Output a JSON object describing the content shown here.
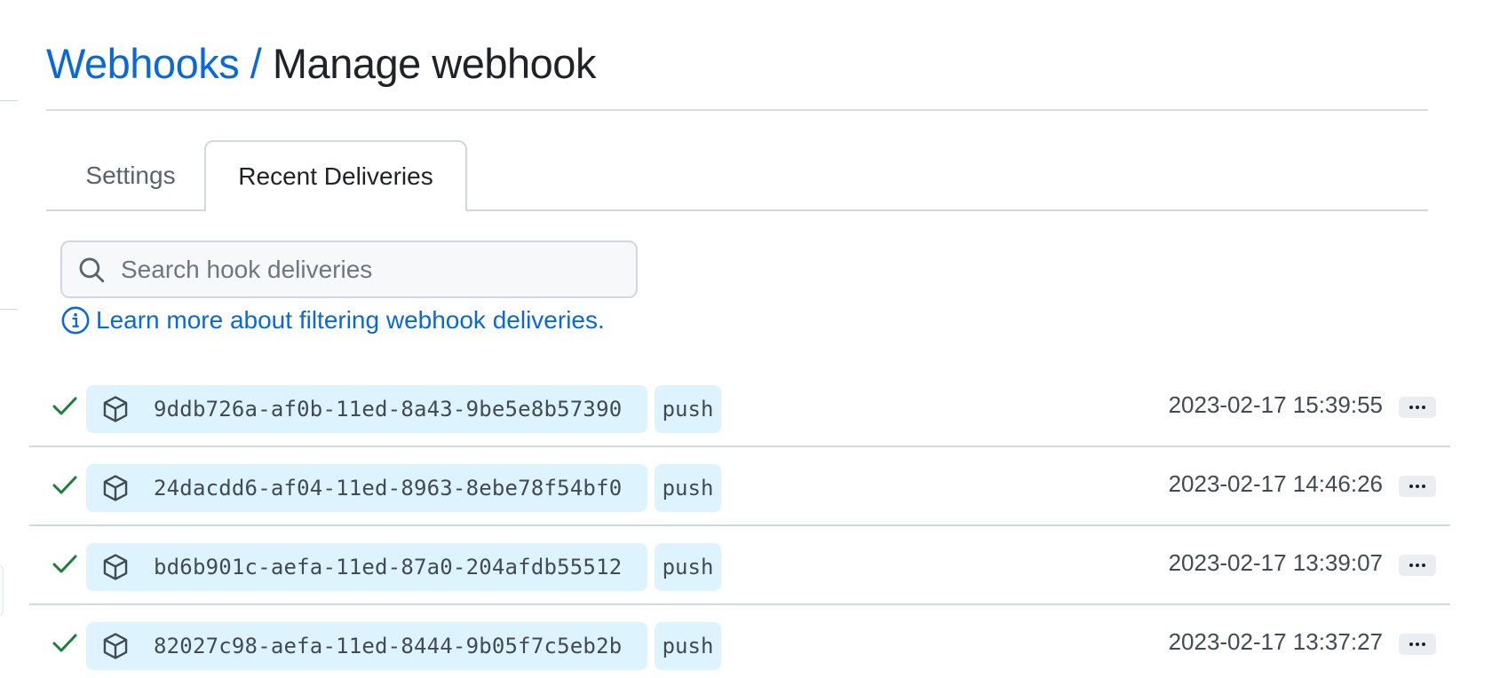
{
  "header": {
    "breadcrumb_link": "Webhooks",
    "separator": "/",
    "current_page": "Manage webhook"
  },
  "tabs": [
    {
      "label": "Settings",
      "selected": false
    },
    {
      "label": "Recent Deliveries",
      "selected": true
    }
  ],
  "search": {
    "placeholder": "Search hook deliveries",
    "value": "",
    "icon": "search-icon"
  },
  "help_link": {
    "label": "Learn more about filtering webhook deliveries.",
    "icon": "info-icon"
  },
  "deliveries": [
    {
      "status": "success",
      "guid": "9ddb726a-af0b-11ed-8a43-9be5e8b57390",
      "event": "push",
      "timestamp": "2023-02-17 15:39:55"
    },
    {
      "status": "success",
      "guid": "24dacdd6-af04-11ed-8963-8ebe78f54bf0",
      "event": "push",
      "timestamp": "2023-02-17 14:46:26"
    },
    {
      "status": "success",
      "guid": "bd6b901c-aefa-11ed-87a0-204afdb55512",
      "event": "push",
      "timestamp": "2023-02-17 13:39:07"
    },
    {
      "status": "success",
      "guid": "82027c98-aefa-11ed-8444-9b05f7c5eb2b",
      "event": "push",
      "timestamp": "2023-02-17 13:37:27"
    }
  ],
  "colors": {
    "link": "#0969da",
    "success": "#1a7f37",
    "pill_bg": "#ddf4ff",
    "border": "#d0d7de"
  }
}
